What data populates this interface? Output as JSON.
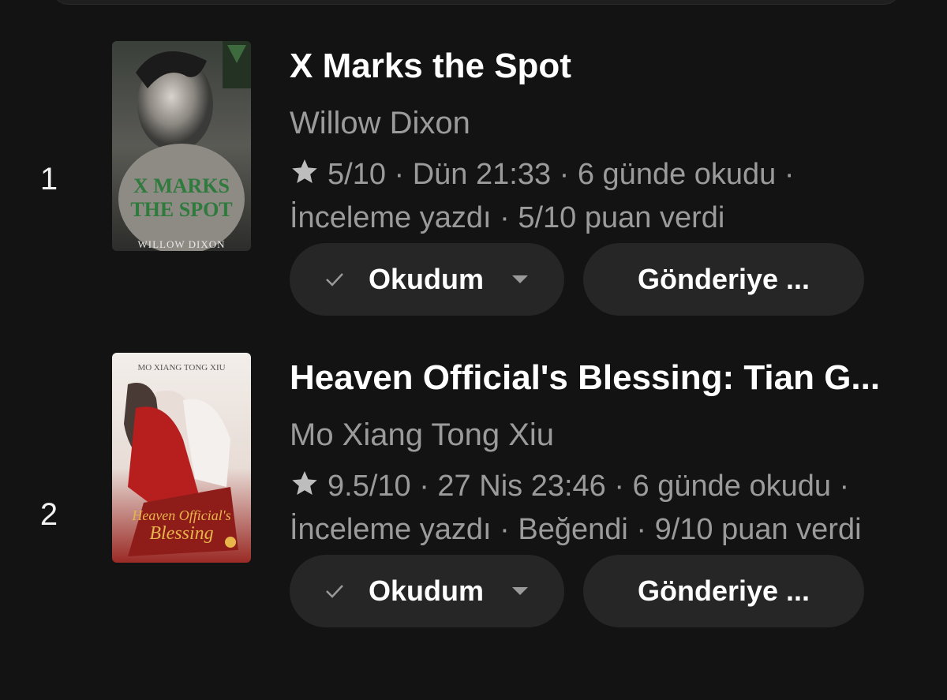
{
  "books": [
    {
      "rank": "1",
      "title": "X Marks the Spot",
      "author": "Willow Dixon",
      "meta": "5/10 · Dün 21:33 · 6 günde okudu · İnceleme yazdı · 5/10 puan verdi",
      "cover_author": "WILLOW DIXON",
      "cover_title_line1": "X MARKS",
      "cover_title_line2": "THE SPOT",
      "status_button": "Okudum",
      "share_button": "Gönderiye ..."
    },
    {
      "rank": "2",
      "title": "Heaven Official's Blessing: Tian G...",
      "author": "Mo Xiang Tong Xiu",
      "meta": "9.5/10 · 27 Nis 23:46 · 6 günde okudu · İnceleme yazdı · Beğendi · 9/10 puan verdi",
      "cover_author": "MO XIANG TONG XIU",
      "cover_title_line1": "Heaven Official's",
      "cover_title_line2": "Blessing",
      "status_button": "Okudum",
      "share_button": "Gönderiye ..."
    }
  ],
  "icons": {
    "rating": "star-icon",
    "status": "check-icon",
    "dropdown": "caret-down-icon"
  },
  "colors": {
    "background": "#131313",
    "button_bg": "#262626",
    "secondary_text": "#9b9b9b",
    "primary_text": "#ffffff"
  }
}
